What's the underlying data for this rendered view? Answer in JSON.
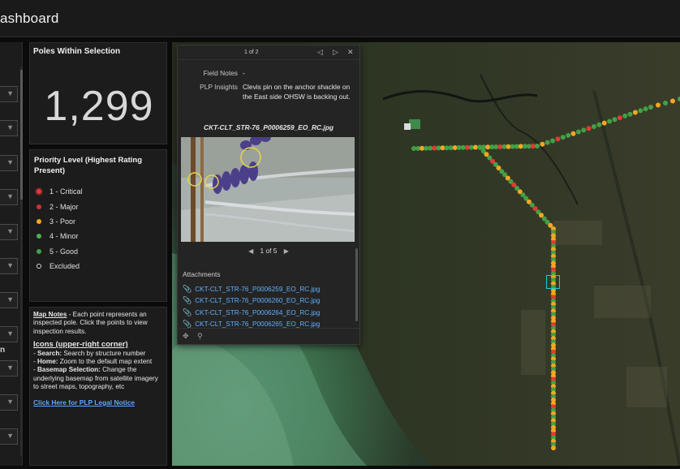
{
  "header": {
    "title": "ashboard"
  },
  "sidebar": {
    "partial_label": "n"
  },
  "poles_card": {
    "title": "Poles Within Selection",
    "count": "1,299"
  },
  "priority_card": {
    "title": "Priority Level (Highest Rating Present)",
    "levels": [
      {
        "label": "1 - Critical",
        "color": "#e53935"
      },
      {
        "label": "2 - Major",
        "color": "#d32f2f"
      },
      {
        "label": "3 - Poor",
        "color": "#f5a623"
      },
      {
        "label": "4 - Minor",
        "color": "#4caf50"
      },
      {
        "label": "5 - Good",
        "color": "#43a047"
      },
      {
        "label": "Excluded",
        "color": "#ffffff"
      }
    ]
  },
  "notes_card": {
    "map_notes_head": "Map Notes",
    "map_notes_text": " - Each point represents an inspected pole. Click the points to view inspection results.",
    "icons_head": "Icons (upper-right corner)",
    "search_label": "Search:",
    "search_text": " Search by structure number",
    "home_label": "Home:",
    "home_text": " Zoom to the default map extent",
    "basemap_label": "Basemap Selection:",
    "basemap_text": " Change the underlying basemap from satellite imagery to street maps, topography, etc",
    "legal_link": "Click Here for PLP Legal Notice"
  },
  "popup": {
    "record_count": "1 of 2",
    "field_notes_key": "Field Notes",
    "field_notes_val": "-",
    "insights_key": "PLP Insights",
    "insights_val": "Clevis pin on the anchor shackle on the East side OHSW is backing out.",
    "photo_caption": "CKT-CLT_STR-76_P0006259_EO_RC.jpg",
    "photo_pager": "1 of 5",
    "attachments_title": "Attachments",
    "attachments": [
      "CKT-CLT_STR-76_P0006259_EO_RC.jpg",
      "CKT-CLT_STR-76_P0006260_EO_RC.jpg",
      "CKT-CLT_STR-76_P0006264_EO_RC.jpg",
      "CKT-CLT_STR-76_P0006265_EO_RC.jpg"
    ]
  },
  "colors": {
    "accent_link": "#5fb0ff",
    "selection": "#26c6da",
    "critical": "#e53935",
    "poor": "#f5a623",
    "good": "#43a047"
  }
}
